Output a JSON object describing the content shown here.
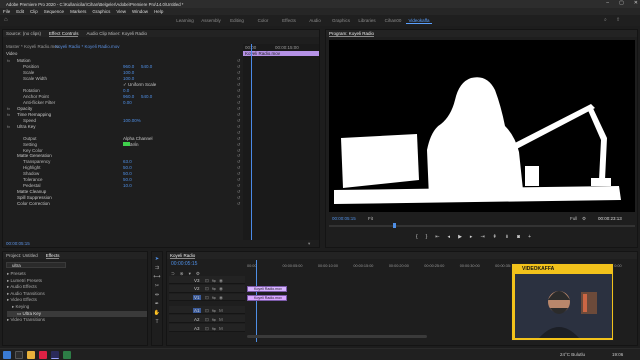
{
  "window": {
    "title": "Adobe Premiere Pro 2020 - C:\\Kullanicilar\\Cihan\\Belgeler\\Adobe\\Premiere Pro\\14.0\\Untitled *"
  },
  "menu": [
    "File",
    "Edit",
    "Clip",
    "Sequence",
    "Markers",
    "Graphics",
    "View",
    "Window",
    "Help"
  ],
  "workspaces": [
    "Learning",
    "Assembly",
    "Editing",
    "Color",
    "Effects",
    "Audio",
    "Graphics",
    "Libraries",
    "Cihan00",
    "Videokaffa"
  ],
  "active_workspace": "Videokaffa",
  "left_panel": {
    "tabs": [
      "Source: (no clips)",
      "Effect Controls",
      "Audio Clip Mixer: Koyeli Radio"
    ],
    "active_tab": "Effect Controls",
    "breadcrumb_master": "Master * Koyeli Radio.mov",
    "breadcrumb_seq": "Koyeli Radio * Koyeli Radio.mov",
    "section": "Video",
    "clip_label": "Koyeli Radio.mov",
    "time_start": "00:00",
    "time_end": "00:00:15:00",
    "footer_time": "00:00:05:15",
    "rows": [
      {
        "fx": "fx",
        "label": "Motion",
        "hdr": true
      },
      {
        "fx": "",
        "label": "Position",
        "v1": "960.0",
        "v2": "540.0"
      },
      {
        "fx": "",
        "label": "Scale",
        "v1": "100.0"
      },
      {
        "fx": "",
        "label": "Scale Width",
        "v1": "100.0"
      },
      {
        "fx": "",
        "label": "",
        "v1": "✓ Uniform Scale"
      },
      {
        "fx": "",
        "label": "Rotation",
        "v1": "0.0"
      },
      {
        "fx": "",
        "label": "Anchor Point",
        "v1": "960.0",
        "v2": "540.0"
      },
      {
        "fx": "",
        "label": "Anti-flicker Filter",
        "v1": "0.00"
      },
      {
        "fx": "fx",
        "label": "Opacity",
        "hdr": true
      },
      {
        "fx": "fx",
        "label": "Time Remapping",
        "hdr": true
      },
      {
        "fx": "",
        "label": "Speed",
        "v1": "100.00%"
      },
      {
        "fx": "fx",
        "label": "Ultra Key",
        "hdr": true
      },
      {
        "fx": "",
        "label": "",
        "v1": ""
      },
      {
        "fx": "",
        "label": "Output",
        "v1": "Alpha Channel"
      },
      {
        "fx": "",
        "label": "Setting",
        "v1": "Custom"
      },
      {
        "fx": "",
        "label": "Key Color",
        "v1": ""
      },
      {
        "fx": "",
        "label": "Matte Generation",
        "hdr": true
      },
      {
        "fx": "",
        "label": "Transparency",
        "v1": "63.0"
      },
      {
        "fx": "",
        "label": "Highlight",
        "v1": "50.0"
      },
      {
        "fx": "",
        "label": "Shadow",
        "v1": "50.0"
      },
      {
        "fx": "",
        "label": "Tolerance",
        "v1": "50.0"
      },
      {
        "fx": "",
        "label": "Pedestal",
        "v1": "10.0"
      },
      {
        "fx": "",
        "label": "Matte Cleanup",
        "hdr": true
      },
      {
        "fx": "",
        "label": "Spill Suppression",
        "hdr": true
      },
      {
        "fx": "",
        "label": "Color Correction",
        "hdr": true
      }
    ]
  },
  "program": {
    "title": "Program: Koyeli Radio",
    "timecode": "00:00:05:15",
    "fit": "Fit",
    "quality": "Full",
    "duration": "00:00:23:13"
  },
  "project": {
    "tabs": [
      "Project: Untitled",
      "Effects"
    ],
    "active_tab": "Effects",
    "search": "ultra",
    "tree": [
      {
        "label": "Presets",
        "indent": 0
      },
      {
        "label": "Lumetri Presets",
        "indent": 0
      },
      {
        "label": "Audio Effects",
        "indent": 0
      },
      {
        "label": "Audio Transitions",
        "indent": 0
      },
      {
        "label": "Video Effects",
        "indent": 0
      },
      {
        "label": "Keying",
        "indent": 1
      },
      {
        "label": "Ultra Key",
        "indent": 2
      },
      {
        "label": "Video Transitions",
        "indent": 0
      }
    ]
  },
  "timeline": {
    "title": "Koyeli Radio",
    "timecode": "00:00:05:15",
    "ruler": [
      "00:00",
      "00:00:05:00",
      "00:00:10:00",
      "00:00:15:00",
      "00:00:20:00",
      "00:00:25:00",
      "00:00:30:00",
      "00:00:35:00",
      "00:00:40:00",
      "00:00:45:00",
      "00:00:50:00"
    ],
    "tracks": [
      "V3",
      "V2",
      "V1",
      "A1",
      "A2",
      "A3"
    ],
    "clips": [
      {
        "label": "Koyeli Radio.mov",
        "track": "V2",
        "color": "#d7b3ff"
      },
      {
        "label": "Koyeli Radio.mov",
        "track": "V1",
        "color": "#d8a6ff"
      }
    ]
  },
  "webcam": {
    "brand": "VIDEOKAFFA"
  },
  "taskbar": {
    "weather": "24°C Bulutlu",
    "time": "19:06"
  },
  "icons": {
    "search": "search-icon",
    "play": "play-icon",
    "wrench": "wrench-icon"
  }
}
